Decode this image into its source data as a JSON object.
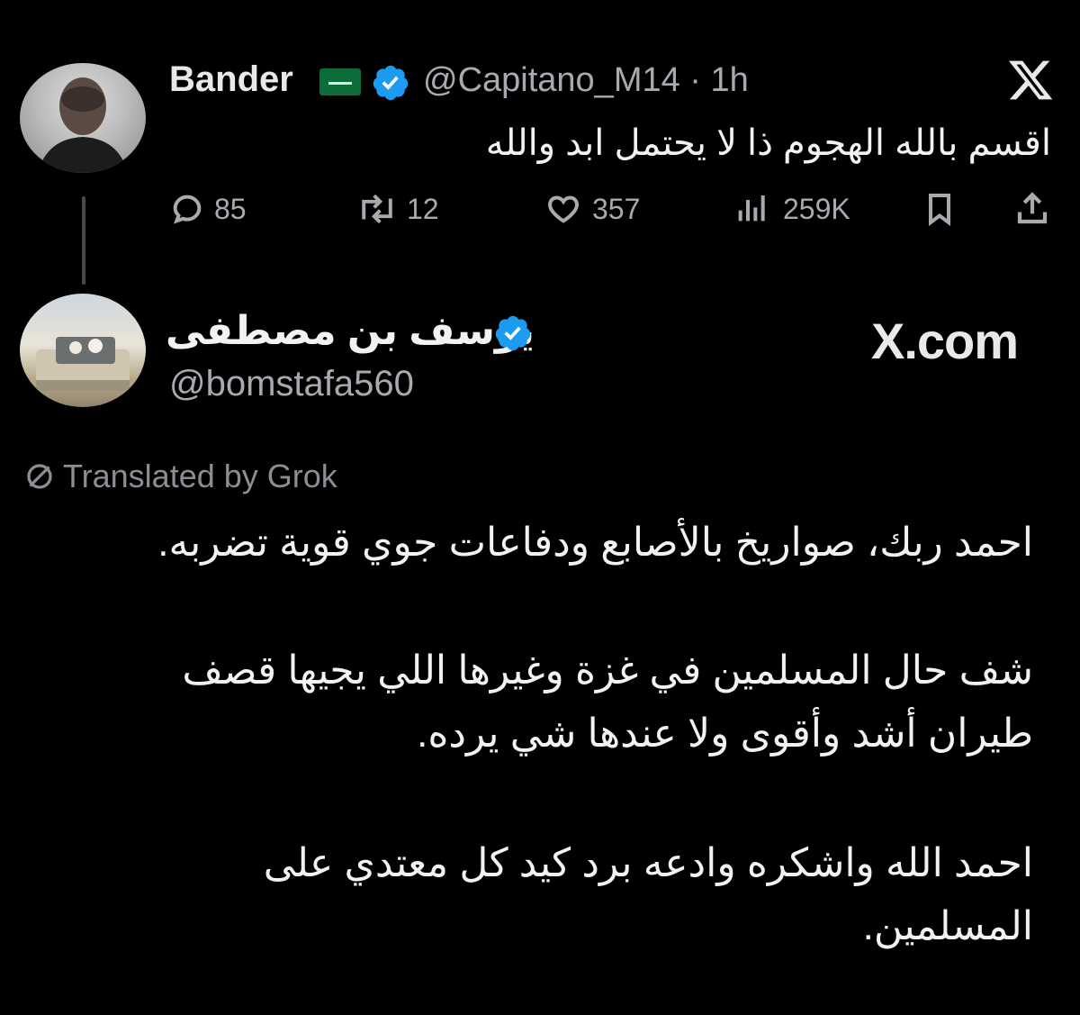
{
  "tweet1": {
    "name": "Bander",
    "flag_icon": "saudi-flag-icon",
    "handle_time": "@Capitano_M14 · 1h",
    "text": "اقسم بالله الهجوم ذا لا يحتمل ابد والله",
    "replies": "85",
    "retweets": "12",
    "likes": "357",
    "views": "259K"
  },
  "tweet2": {
    "name": "يوسف بن مصطفى",
    "handle": "@bomstafa560",
    "site": "X.com",
    "translated_label": "Translated by Grok",
    "paragraphs": [
      "احمد ربك، صواريخ بالأصابع ودفاعات جوي قوية تضربه.",
      "شف حال المسلمين في غزة وغيرها اللي يجيها قصف",
      "طيران أشد وأقوى ولا عندها شي يرده.",
      "احمد الله واشكره وادعه برد كيد كل معتدي على",
      "المسلمين."
    ]
  },
  "colors": {
    "background": "#000000",
    "text": "#e7e9ea",
    "secondary": "#a7abb0",
    "verified": "#1d9bf0"
  }
}
